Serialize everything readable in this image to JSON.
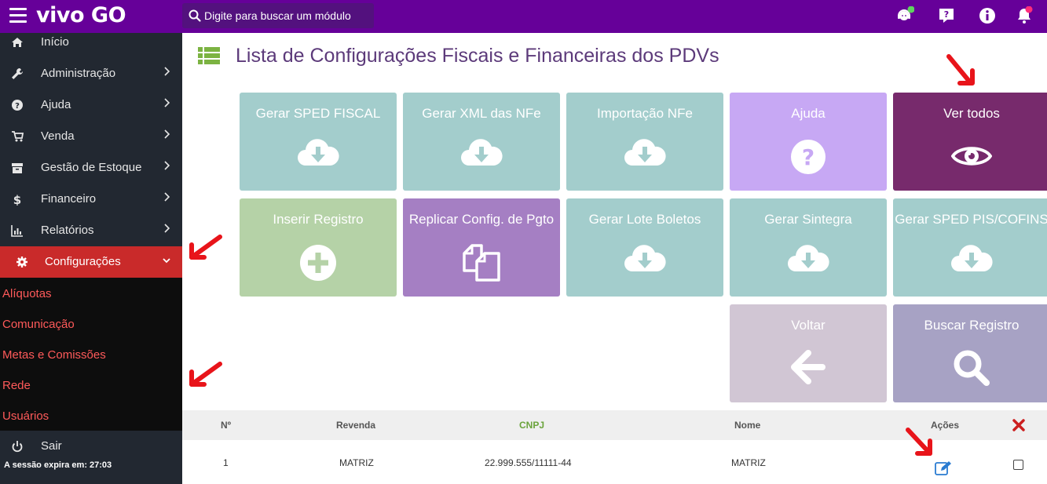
{
  "topbar": {
    "logo_text": "vivo GO",
    "search_placeholder": "Digite para buscar um módulo",
    "brand_color": "#660099",
    "icons": [
      "support-agent-icon",
      "help-question-icon",
      "info-icon",
      "notification-bell-icon"
    ]
  },
  "sidebar": {
    "items": [
      {
        "label": "Início",
        "icon": "home-icon"
      },
      {
        "label": "Administração",
        "icon": "wrench-icon"
      },
      {
        "label": "Ajuda",
        "icon": "question-circle-icon"
      },
      {
        "label": "Venda",
        "icon": "cart-icon"
      },
      {
        "label": "Gestão de Estoque",
        "icon": "archive-icon"
      },
      {
        "label": "Financeiro",
        "icon": "dollar-icon"
      },
      {
        "label": "Relatórios",
        "icon": "bar-chart-icon"
      },
      {
        "label": "Configurações",
        "icon": "gear-icon"
      }
    ],
    "submenu": [
      "Alíquotas",
      "Comunicação",
      "Metas e Comissões",
      "Rede",
      "Usuários"
    ],
    "logout_label": "Sair",
    "session_text": "A sessão expira em: 27:03"
  },
  "page": {
    "title": "Lista de Configurações Fiscais e Financeiras dos PDVs"
  },
  "tiles": [
    {
      "label": "Gerar SPED FISCAL",
      "icon": "cloud-download-icon"
    },
    {
      "label": "Gerar XML das NFe",
      "icon": "cloud-download-icon"
    },
    {
      "label": "Importação NFe",
      "icon": "cloud-download-icon"
    },
    {
      "label": "Ajuda",
      "icon": "question-circle-icon"
    },
    {
      "label": "Ver todos",
      "icon": "eye-icon"
    },
    {
      "label": "Inserir Registro",
      "icon": "plus-circle-icon"
    },
    {
      "label": "Replicar Config. de Pgto",
      "icon": "copy-icon"
    },
    {
      "label": "Gerar Lote Boletos",
      "icon": "cloud-download-icon"
    },
    {
      "label": "Gerar Sintegra",
      "icon": "cloud-download-icon"
    },
    {
      "label": "Gerar SPED PIS/COFINS",
      "icon": "cloud-download-icon"
    },
    {
      "label": "Voltar",
      "icon": "arrow-left-icon"
    },
    {
      "label": "Buscar Registro",
      "icon": "search-icon"
    }
  ],
  "table": {
    "headers": [
      "Nº",
      "Revenda",
      "CNPJ",
      "Nome",
      "Ações"
    ],
    "rows": [
      {
        "numero": "1",
        "revenda": "MATRIZ",
        "cnpj": "22.999.555/11111-44",
        "nome": "MATRIZ"
      }
    ]
  }
}
